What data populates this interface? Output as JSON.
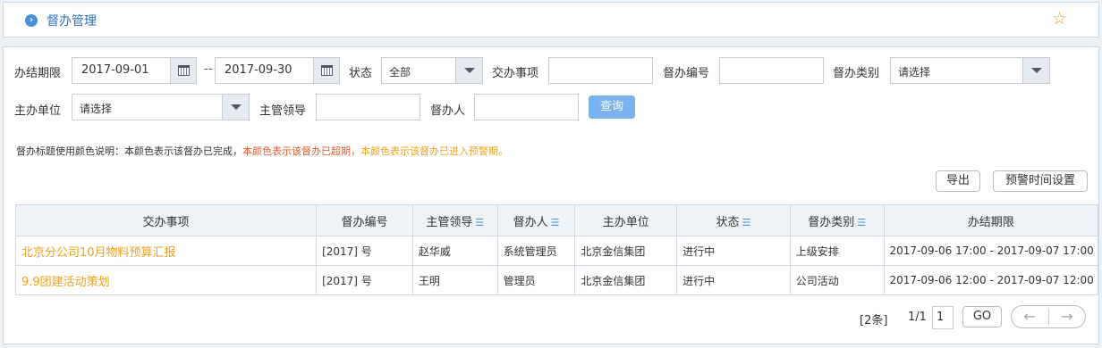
{
  "header": {
    "title": "督办管理"
  },
  "filters": {
    "deadline_label": "办结期限",
    "date_from": "2017-09-01",
    "date_sep": "--",
    "date_to": "2017-09-30",
    "status_label": "状态",
    "status_value": "全部",
    "task_label": "交办事项",
    "task_value": "",
    "number_label": "督办编号",
    "number_value": "",
    "category_label": "督办类别",
    "category_value": "请选择",
    "unit_label": "主办单位",
    "unit_value": "请选择",
    "leader_label": "主管领导",
    "leader_value": "",
    "person_label": "督办人",
    "person_value": "",
    "query_button": "查询"
  },
  "legend": {
    "prefix": "督办标题使用颜色说明：本颜色表示该督办已完成，",
    "overdue": "本颜色表示该督办已超期，",
    "warning": "本颜色表示该督办已进入预警期。"
  },
  "toolbar": {
    "export": "导出",
    "warning_settings": "预警时间设置"
  },
  "table": {
    "headers": [
      "交办事项",
      "督办编号",
      "主管领导",
      "督办人",
      "主办单位",
      "状态",
      "督办类别",
      "办结期限"
    ],
    "rows": [
      [
        "北京分公司10月物料预算汇报",
        "[2017] 号",
        "赵华威",
        "系统管理员",
        "北京金信集团",
        "进行中",
        "上级安排",
        "2017-09-06 17:00 - 2017-09-07 17:00"
      ],
      [
        "9.9团建活动策划",
        "[2017] 号",
        "王明",
        "管理员",
        "北京金信集团",
        "进行中",
        "公司活动",
        "2017-09-06 12:00 - 2017-09-07 12:00"
      ]
    ]
  },
  "pagination": {
    "total": "[2条]",
    "page": "1/1",
    "page_input": "1",
    "go": "GO"
  },
  "colors": {
    "accent": "#4a90d9",
    "title_warning": "#f0a21c",
    "overdue": "#e35a2c",
    "query": "#7ab3ef"
  }
}
